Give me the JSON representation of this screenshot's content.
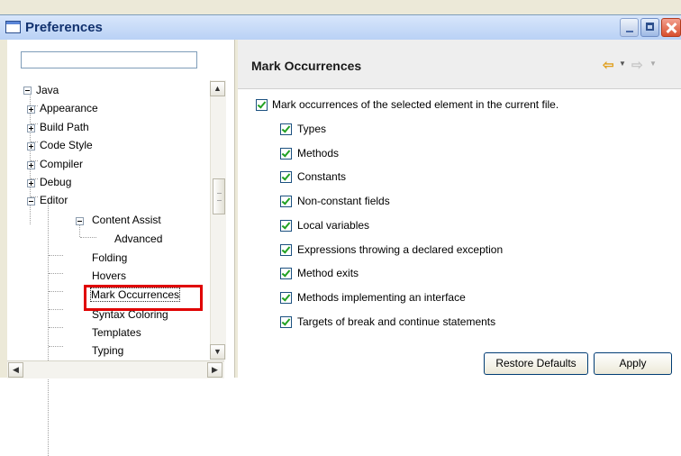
{
  "window": {
    "title": "Preferences"
  },
  "filter": {
    "value": ""
  },
  "tree": {
    "items": [
      {
        "label": "Java",
        "expanded": true
      },
      {
        "label": "Appearance"
      },
      {
        "label": "Build Path"
      },
      {
        "label": "Code Style"
      },
      {
        "label": "Compiler"
      },
      {
        "label": "Debug"
      },
      {
        "label": "Editor",
        "expanded": true
      },
      {
        "label": "Content Assist",
        "expanded": true
      },
      {
        "label": "Advanced"
      },
      {
        "label": "Folding"
      },
      {
        "label": "Hovers"
      },
      {
        "label": "Mark Occurrences",
        "selected": true
      },
      {
        "label": "Syntax Coloring"
      },
      {
        "label": "Templates"
      },
      {
        "label": "Typing"
      }
    ]
  },
  "page": {
    "title": "Mark Occurrences",
    "main_option": {
      "label": "Mark occurrences of the selected element in the current file.",
      "checked": true
    },
    "options": [
      {
        "label": "Types",
        "checked": true
      },
      {
        "label": "Methods",
        "checked": true
      },
      {
        "label": "Constants",
        "checked": true
      },
      {
        "label": "Non-constant fields",
        "checked": true
      },
      {
        "label": "Local variables",
        "checked": true
      },
      {
        "label": "Expressions throwing a declared exception",
        "checked": true
      },
      {
        "label": "Method exits",
        "checked": true
      },
      {
        "label": "Methods implementing an interface",
        "checked": true
      },
      {
        "label": "Targets of break and continue statements",
        "checked": true
      }
    ],
    "buttons": {
      "restore_defaults": "Restore Defaults",
      "apply": "Apply"
    }
  },
  "colors": {
    "highlight": "#e00000",
    "check": "#21a121",
    "nav_back": "#e0a020"
  },
  "icons": [
    "window-icon",
    "minimize-icon",
    "maximize-icon",
    "close-icon",
    "back-arrow-icon",
    "forward-arrow-icon",
    "dropdown-icon",
    "scroll-up-icon",
    "scroll-down-icon",
    "scroll-left-icon",
    "scroll-right-icon"
  ]
}
